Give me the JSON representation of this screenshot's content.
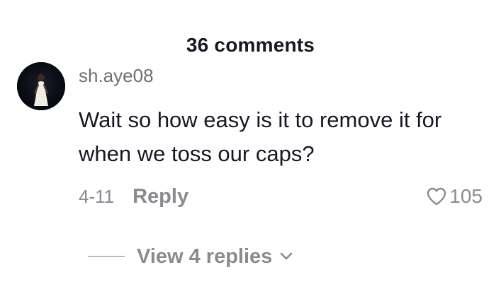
{
  "header": {
    "comment_count": "36 comments"
  },
  "comment": {
    "username": "sh.aye08",
    "text": "Wait so how easy is it to remove it for when we toss our caps?",
    "date": "4-11",
    "reply_label": "Reply",
    "likes": "105",
    "avatar_icon": "user-avatar-photo",
    "like_icon": "heart-outline-icon"
  },
  "replies": {
    "view_label": "View 4 replies",
    "expand_icon": "chevron-down-icon"
  },
  "colors": {
    "primary_text": "#161823",
    "secondary_text": "#8a8b91",
    "divider": "#b9babd"
  }
}
